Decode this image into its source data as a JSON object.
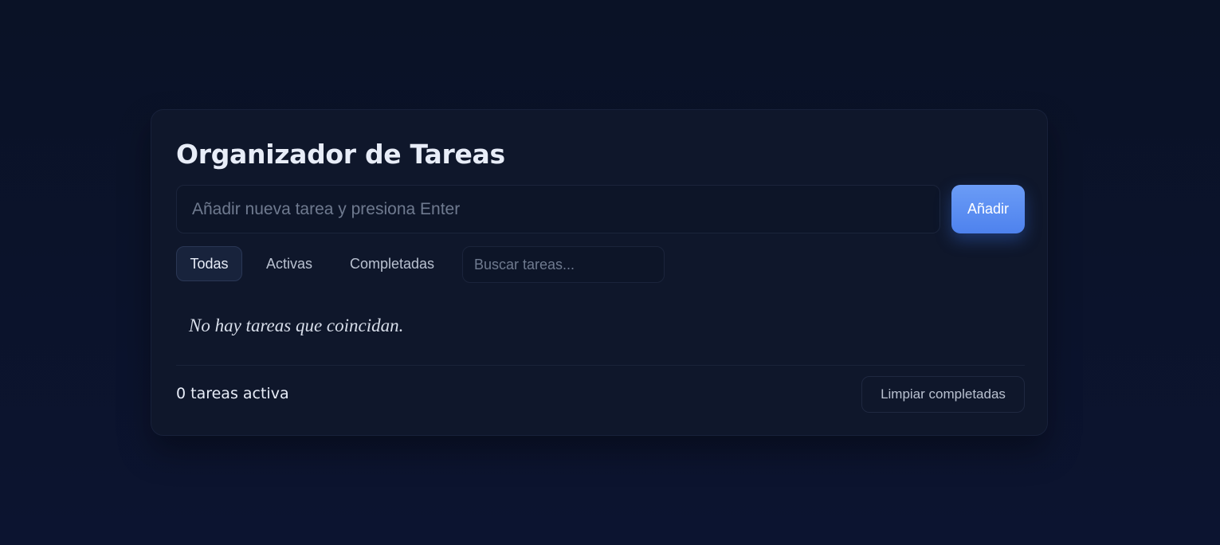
{
  "app": {
    "title": "Organizador de Tareas"
  },
  "new_task": {
    "value": "",
    "placeholder": "Añadir nueva tarea y presiona Enter",
    "add_label": "Añadir"
  },
  "filters": [
    {
      "label": "Todas",
      "active": true
    },
    {
      "label": "Activas",
      "active": false
    },
    {
      "label": "Completadas",
      "active": false
    }
  ],
  "search": {
    "value": "",
    "placeholder": "Buscar tareas..."
  },
  "list": {
    "empty_message": "No hay tareas que coincidan."
  },
  "footer": {
    "count_text": "0 tareas activa",
    "clear_label": "Limpiar completadas"
  },
  "colors": {
    "background": "#0a1226",
    "card": "#0f172b",
    "accent": "#5b8ef3",
    "text": "#e8edf8",
    "muted": "#b9c1d0"
  }
}
